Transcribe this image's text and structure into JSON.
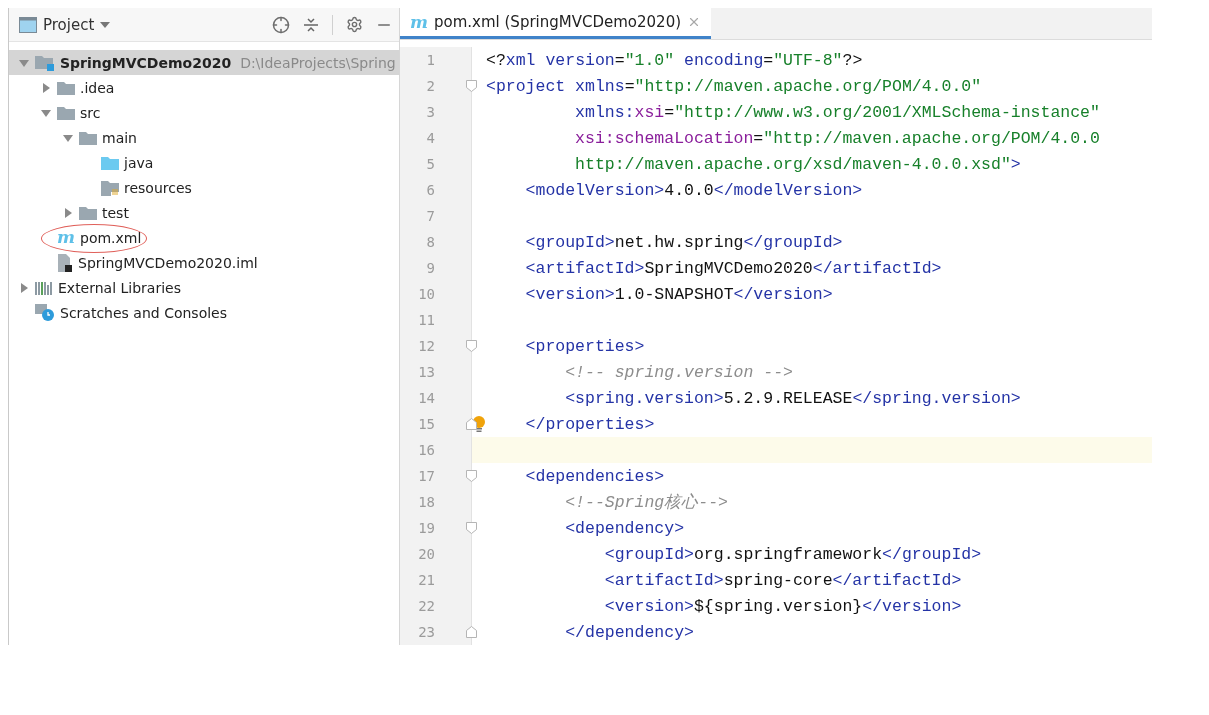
{
  "project_panel": {
    "title": "Project",
    "tree": [
      {
        "label": "SpringMVCDemo2020",
        "path": "D:\\IdeaProjects\\Spring",
        "kind": "module",
        "expanded": true,
        "selected": true,
        "children": [
          {
            "label": ".idea",
            "kind": "folder",
            "expanded": false,
            "selected": false
          },
          {
            "label": "src",
            "kind": "folder",
            "expanded": true,
            "selected": false,
            "children": [
              {
                "label": "main",
                "kind": "folder",
                "expanded": true,
                "selected": false,
                "children": [
                  {
                    "label": "java",
                    "kind": "source",
                    "selected": false
                  },
                  {
                    "label": "resources",
                    "kind": "resources",
                    "selected": false
                  }
                ]
              },
              {
                "label": "test",
                "kind": "folder",
                "expanded": false,
                "selected": false
              }
            ]
          },
          {
            "label": "pom.xml",
            "kind": "maven",
            "icon_glyph": "m",
            "circled": true,
            "selected": false
          },
          {
            "label": "SpringMVCDemo2020.iml",
            "kind": "file",
            "selected": false
          }
        ]
      },
      {
        "label": "External Libraries",
        "kind": "libraries",
        "expanded": false,
        "selected": false
      },
      {
        "label": "Scratches and Consoles",
        "kind": "scratches",
        "selected": false
      }
    ]
  },
  "editor": {
    "tabs": [
      {
        "label": "pom.xml (SpringMVCDemo2020)",
        "icon_glyph": "m",
        "selected": true
      }
    ],
    "lines": [
      {
        "number": "1",
        "tokens": [
          {
            "t": "<?",
            "kind": "text"
          },
          {
            "t": "xml",
            "kind": "tag"
          },
          {
            "t": " version",
            "kind": "attr"
          },
          {
            "t": "=",
            "kind": "text"
          },
          {
            "t": "\"1.0\"",
            "kind": "value"
          },
          {
            "t": " encoding",
            "kind": "attr"
          },
          {
            "t": "=",
            "kind": "text"
          },
          {
            "t": "\"UTF-8\"",
            "kind": "value"
          },
          {
            "t": "?>",
            "kind": "text"
          }
        ]
      },
      {
        "number": "2",
        "fold_start": true,
        "tokens": [
          {
            "t": "<project",
            "kind": "tag"
          },
          {
            "t": " xmlns",
            "kind": "attr"
          },
          {
            "t": "=",
            "kind": "text"
          },
          {
            "t": "\"http://maven.apache.org/POM/4.0.0\"",
            "kind": "value"
          }
        ]
      },
      {
        "number": "3",
        "tokens": [
          {
            "t": "         xmlns:",
            "kind": "attr"
          },
          {
            "t": "xsi",
            "kind": "ns"
          },
          {
            "t": "=",
            "kind": "text"
          },
          {
            "t": "\"http://www.w3.org/2001/XMLSchema-instance\"",
            "kind": "value"
          }
        ]
      },
      {
        "number": "4",
        "tokens": [
          {
            "t": "         xsi:schemaLocation",
            "kind": "ns"
          },
          {
            "t": "=",
            "kind": "text"
          },
          {
            "t": "\"http://maven.apache.org/POM/4.0.0",
            "kind": "value"
          }
        ]
      },
      {
        "number": "5",
        "tokens": [
          {
            "t": "         http://maven.apache.org/xsd/maven-4.0.0.xsd\"",
            "kind": "value"
          },
          {
            "t": ">",
            "kind": "tag"
          }
        ]
      },
      {
        "number": "6",
        "tokens": [
          {
            "t": "    <modelVersion>",
            "kind": "tag"
          },
          {
            "t": "4.0.0",
            "kind": "text"
          },
          {
            "t": "</modelVersion>",
            "kind": "tag"
          }
        ]
      },
      {
        "number": "7"
      },
      {
        "number": "8",
        "tokens": [
          {
            "t": "    <groupId>",
            "kind": "tag"
          },
          {
            "t": "net.hw.spring",
            "kind": "text"
          },
          {
            "t": "</groupId>",
            "kind": "tag"
          }
        ]
      },
      {
        "number": "9",
        "tokens": [
          {
            "t": "    <artifactId>",
            "kind": "tag"
          },
          {
            "t": "SpringMVCDemo2020",
            "kind": "text"
          },
          {
            "t": "</artifactId>",
            "kind": "tag"
          }
        ]
      },
      {
        "number": "10",
        "tokens": [
          {
            "t": "    <version>",
            "kind": "tag"
          },
          {
            "t": "1.0-SNAPSHOT",
            "kind": "text"
          },
          {
            "t": "</version>",
            "kind": "tag"
          }
        ]
      },
      {
        "number": "11"
      },
      {
        "number": "12",
        "fold_start": true,
        "tokens": [
          {
            "t": "    <properties>",
            "kind": "tag"
          }
        ]
      },
      {
        "number": "13",
        "tokens": [
          {
            "t": "        <!-- spring.version -->",
            "kind": "comment"
          }
        ]
      },
      {
        "number": "14",
        "tokens": [
          {
            "t": "        <spring.version>",
            "kind": "tag"
          },
          {
            "t": "5.2.9.RELEASE",
            "kind": "text"
          },
          {
            "t": "</spring.version>",
            "kind": "tag"
          }
        ]
      },
      {
        "number": "15",
        "fold_end": true,
        "bulb": true,
        "tokens": [
          {
            "t": "    </properties>",
            "kind": "tag"
          }
        ]
      },
      {
        "number": "16",
        "current": true
      },
      {
        "number": "17",
        "fold_start": true,
        "tokens": [
          {
            "t": "    <dependencies>",
            "kind": "tag"
          }
        ]
      },
      {
        "number": "18",
        "tokens": [
          {
            "t": "        <!--Spring核心-->",
            "kind": "comment"
          }
        ]
      },
      {
        "number": "19",
        "fold_start": true,
        "tokens": [
          {
            "t": "        <dependency>",
            "kind": "tag"
          }
        ]
      },
      {
        "number": "20",
        "tokens": [
          {
            "t": "            <groupId>",
            "kind": "tag"
          },
          {
            "t": "org.springframework",
            "kind": "text"
          },
          {
            "t": "</groupId>",
            "kind": "tag"
          }
        ]
      },
      {
        "number": "21",
        "tokens": [
          {
            "t": "            <artifactId>",
            "kind": "tag"
          },
          {
            "t": "spring-core",
            "kind": "text"
          },
          {
            "t": "</artifactId>",
            "kind": "tag"
          }
        ]
      },
      {
        "number": "22",
        "tokens": [
          {
            "t": "            <version>",
            "kind": "tag"
          },
          {
            "t": "${spring.version}",
            "kind": "text"
          },
          {
            "t": "</version>",
            "kind": "tag"
          }
        ]
      },
      {
        "number": "23",
        "fold_end": true,
        "tokens": [
          {
            "t": "        </dependency>",
            "kind": "tag"
          }
        ]
      }
    ]
  }
}
